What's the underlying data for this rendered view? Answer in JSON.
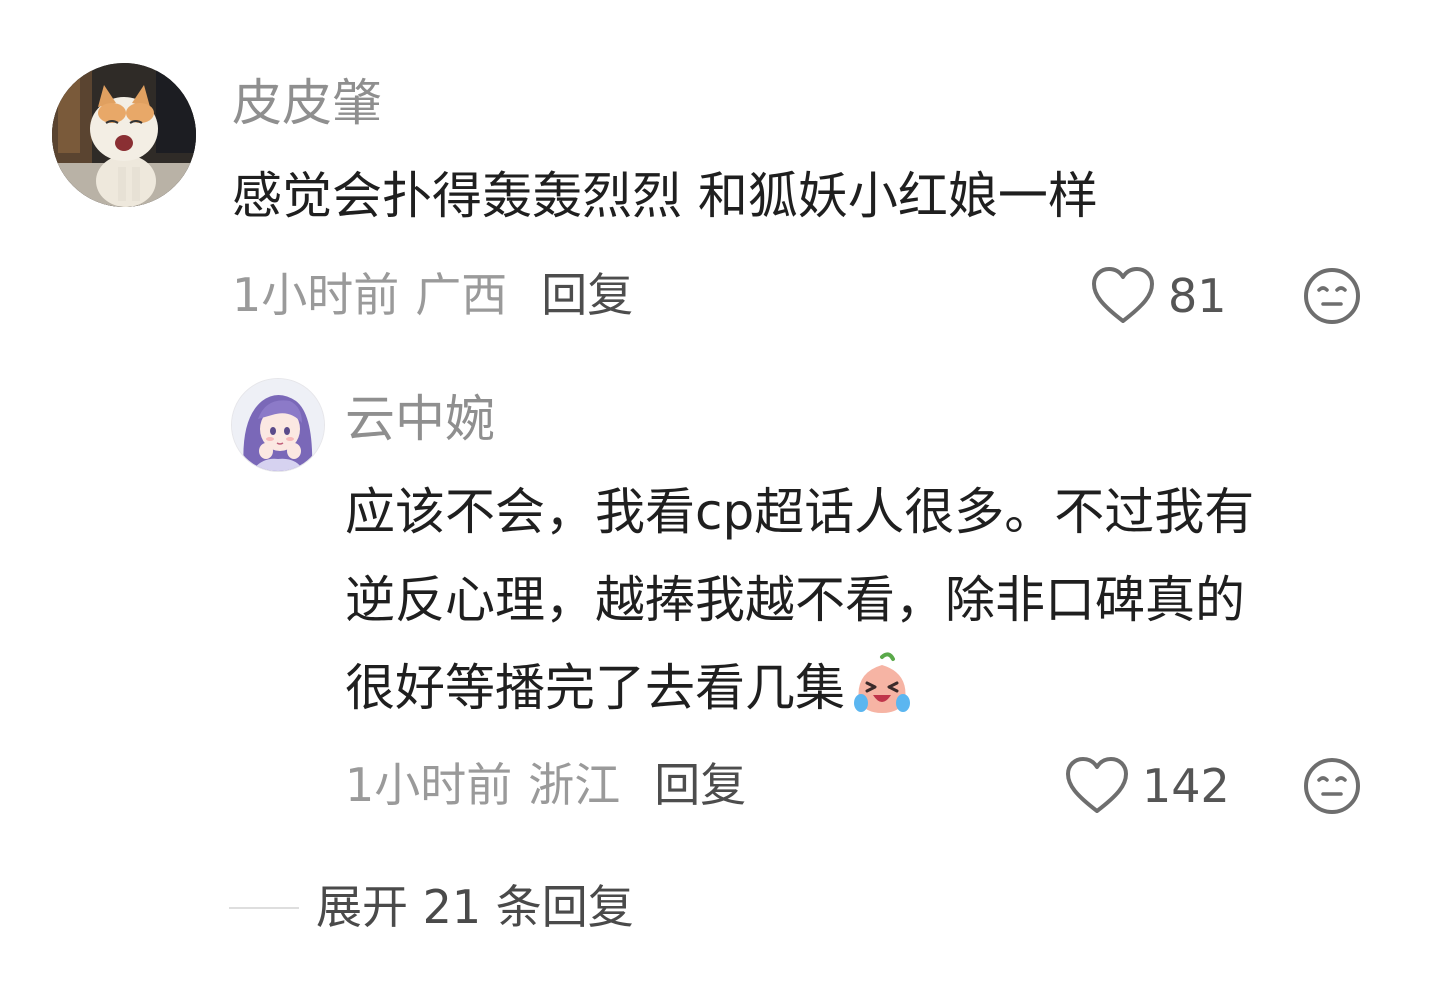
{
  "comment": {
    "username": "皮皮肇",
    "text": "感觉会扑得轰轰烈烈 和狐妖小红娘一样",
    "time": "1小时前",
    "location": "广西",
    "reply_label": "回复",
    "likes": "81"
  },
  "reply": {
    "username": "云中婉",
    "text_line1": "应该不会，我看cp超话人很多。不过我有",
    "text_line2": "逆反心理，越捧我越不看，除非口碑真的",
    "text_line3": "很好等播完了去看几集",
    "emoji": "laughing-crying-face",
    "time": "1小时前",
    "location": "浙江",
    "reply_label": "回复",
    "likes": "142"
  },
  "expand": {
    "label": "展开 21 条回复"
  },
  "icons": {
    "like": "heart-icon",
    "dislike": "meh-face-icon"
  },
  "colors": {
    "username": "#8f8f8f",
    "text": "#1f1f1f",
    "meta": "#9a9a9a"
  }
}
